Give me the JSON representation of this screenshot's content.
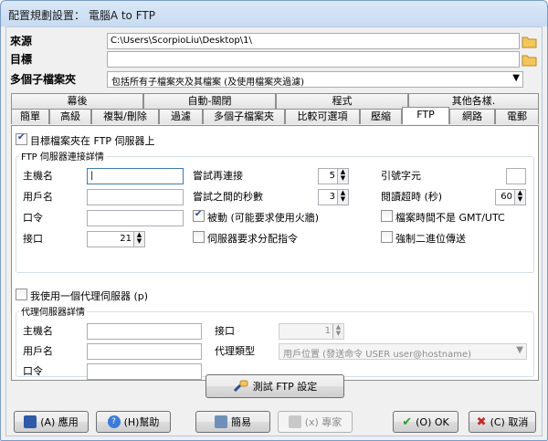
{
  "window": {
    "title": "配置規劃設置： 電腦A to FTP"
  },
  "source": {
    "label": "來源",
    "value": "C:\\Users\\ScorpioLiu\\Desktop\\1\\"
  },
  "target": {
    "label": "目標",
    "value": ""
  },
  "subfolders": {
    "label": "多個子檔案夾",
    "selected": "包括所有子檔案夾及其檔案 (及使用檔案夾過濾)"
  },
  "tabs_row1": [
    "幕後",
    "自動-關閉",
    "程式",
    "其他各樣."
  ],
  "tabs_row2": [
    "簡單",
    "高級",
    "複製/刪除",
    "過濾",
    "多個子檔案夾",
    "比較可選項",
    "壓縮",
    "FTP",
    "網路",
    "電郵"
  ],
  "ftp": {
    "target_on_ftp": "目標檔案夾在 FTP 伺服器上",
    "conn_group": "FTP 伺服器連接詳情",
    "host_label": "主機名",
    "user_label": "用戶名",
    "pass_label": "口令",
    "port_label": "接口",
    "port_value": "21",
    "retry_label": "嘗試再連接",
    "retry_value": "5",
    "retry_delay_label": "嘗試之間的秒數",
    "retry_delay_value": "3",
    "passive_label": "被動 (可能要求使用火牆)",
    "server_alloc_label": "伺服器要求分配指令",
    "quote_label": "引號字元",
    "timeout_label": "閱讀超時 (秒)",
    "timeout_value": "60",
    "gmt_label": "檔案時間不是 GMT/UTC",
    "binary_label": "強制二進位傳送",
    "proxy_check": "我使用一個代理伺服器 (p)",
    "proxy_group": "代理伺服器詳情",
    "proxy_host_label": "主機名",
    "proxy_user_label": "用戶名",
    "proxy_pass_label": "口令",
    "proxy_port_label": "接口",
    "proxy_port_value": "1",
    "proxy_type_label": "代理類型",
    "proxy_type_value": "用戶位置 (發送命令 USER user@hostname)",
    "test_button": "測試 FTP 設定"
  },
  "buttons": {
    "apply": "(A) 應用",
    "help": "(H)幫助",
    "simple": "簡易",
    "expert": "(x) 專家",
    "ok": "(O) OK",
    "cancel": "(C) 取消"
  },
  "colors": {
    "accent": "#2c4a9a",
    "panel": "#f0f0f0"
  }
}
